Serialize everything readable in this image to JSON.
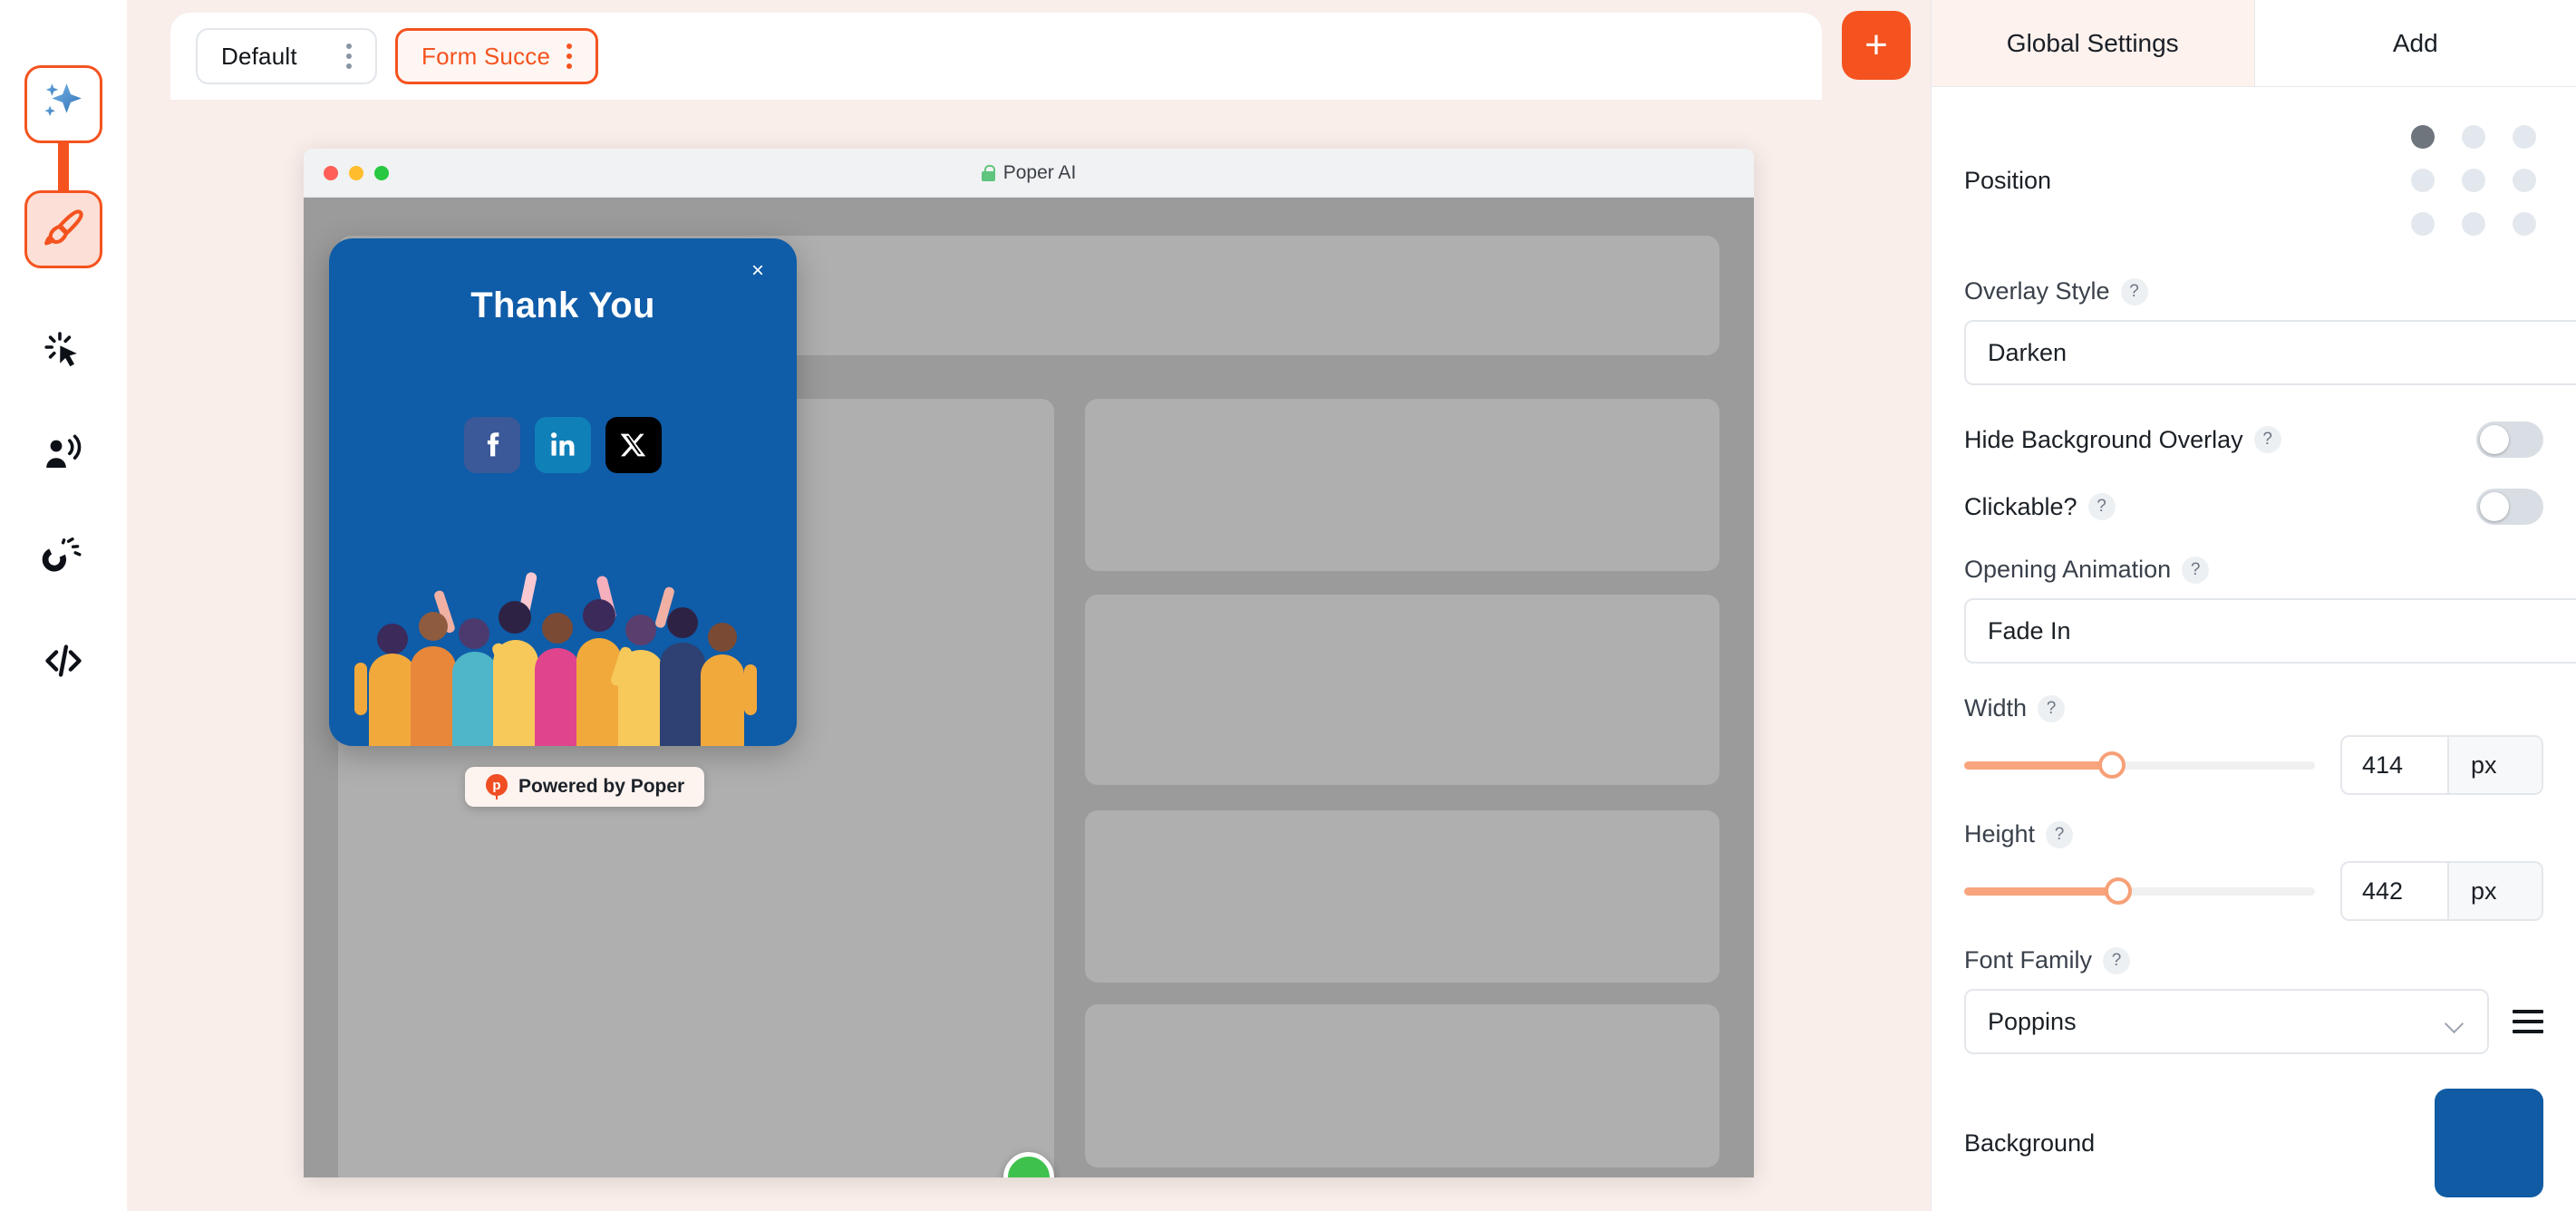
{
  "rail": {
    "items": [
      {
        "name": "ai-sparkle",
        "icon": "sparkle-icon",
        "state": "primary"
      },
      {
        "name": "design-brush",
        "icon": "paintbrush-icon",
        "state": "active"
      },
      {
        "name": "triggers",
        "icon": "click-cursor-icon",
        "state": "plain"
      },
      {
        "name": "audience",
        "icon": "audience-icon",
        "state": "plain"
      },
      {
        "name": "integrations",
        "icon": "magnet-icon",
        "state": "plain"
      },
      {
        "name": "embed-code",
        "icon": "code-icon",
        "state": "plain"
      }
    ]
  },
  "toolbar": {
    "tabs": [
      {
        "label": "Default",
        "selected": false
      },
      {
        "label": "Form Succe",
        "selected": true
      }
    ],
    "add_label": "+"
  },
  "browser": {
    "title": "Poper AI",
    "lock_icon": "lock-icon",
    "traffic_lights": [
      "#FF5F57",
      "#FFBD2E",
      "#28C840"
    ]
  },
  "popup": {
    "title": "Thank You",
    "close_label": "×",
    "socials": [
      {
        "name": "facebook",
        "glyph": "f"
      },
      {
        "name": "linkedin",
        "glyph": "in"
      },
      {
        "name": "x-twitter",
        "glyph": "𝕏"
      }
    ],
    "badge": {
      "text": "Powered by Poper",
      "mark": "p"
    },
    "background_color": "#0F5CA8"
  },
  "panel": {
    "tabs": [
      {
        "label": "Global Settings",
        "active": true
      },
      {
        "label": "Add",
        "active": false
      }
    ],
    "position": {
      "label": "Position",
      "selected_index": 0,
      "cells": 9
    },
    "overlay_style": {
      "label": "Overlay Style",
      "help": "?",
      "value": "Darken"
    },
    "hide_background_overlay": {
      "label": "Hide Background Overlay",
      "help": "?",
      "value": "off"
    },
    "clickable": {
      "label": "Clickable?",
      "help": "?",
      "value": "off"
    },
    "opening_animation": {
      "label": "Opening Animation",
      "help": "?",
      "value": "Fade In"
    },
    "width": {
      "label": "Width",
      "help": "?",
      "value": "414",
      "unit": "px",
      "percent": 42
    },
    "height": {
      "label": "Height",
      "help": "?",
      "value": "442",
      "unit": "px",
      "percent": 44
    },
    "font_family": {
      "label": "Font Family",
      "help": "?",
      "value": "Poppins"
    },
    "background": {
      "label": "Background",
      "color": "#115BA4"
    }
  },
  "colors": {
    "accent": "#F4531F",
    "canvas_bg": "#F9EEEA",
    "panel_active": "#FDF2EE",
    "slider_fill": "#F8A47C",
    "popup_blue": "#0F5CA8",
    "handle_green": "#3FC14E"
  }
}
